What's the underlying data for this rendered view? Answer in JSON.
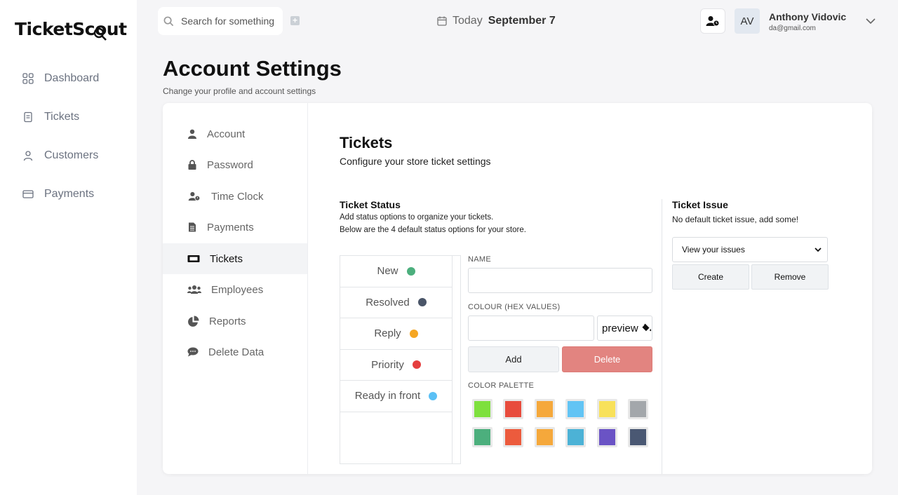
{
  "app": {
    "logo": "TicketScout"
  },
  "sidebar": {
    "items": [
      {
        "label": "Dashboard",
        "icon": "grid-icon"
      },
      {
        "label": "Tickets",
        "icon": "document-icon"
      },
      {
        "label": "Customers",
        "icon": "user-icon"
      },
      {
        "label": "Payments",
        "icon": "credit-card-icon"
      }
    ]
  },
  "header": {
    "search_placeholder": "Search for something",
    "today_label": "Today",
    "today_date": "September 7",
    "user_initials": "AV",
    "user_name": "Anthony Vidovic",
    "user_email": "da@gmail.com"
  },
  "page": {
    "title": "Account Settings",
    "subtitle": "Change your profile and account settings"
  },
  "settings_nav": {
    "active": "Tickets",
    "items": [
      {
        "label": "Account",
        "icon": "user-solid-icon"
      },
      {
        "label": "Password",
        "icon": "lock-icon"
      },
      {
        "label": "Time Clock",
        "icon": "user-clock-icon"
      },
      {
        "label": "Payments",
        "icon": "file-invoice-icon"
      },
      {
        "label": "Tickets",
        "icon": "ticket-icon"
      },
      {
        "label": "Employees",
        "icon": "users-icon"
      },
      {
        "label": "Reports",
        "icon": "pie-chart-icon"
      },
      {
        "label": "Delete Data",
        "icon": "comment-icon"
      }
    ]
  },
  "tickets": {
    "title": "Tickets",
    "subtitle": "Configure your store ticket settings",
    "status": {
      "title": "Ticket Status",
      "desc1": "Add status options to organize your tickets.",
      "desc2": "Below are the 4 default status options for your store.",
      "items": [
        {
          "label": "New",
          "color": "#4caf7d"
        },
        {
          "label": "Resolved",
          "color": "#4a5568"
        },
        {
          "label": "Reply",
          "color": "#f5a623"
        },
        {
          "label": "Priority",
          "color": "#e53e3e"
        },
        {
          "label": "Ready in front",
          "color": "#5bc0f5"
        }
      ]
    },
    "form": {
      "name_label": "NAME",
      "name_value": "",
      "colour_label": "COLOUR (HEX VALUES)",
      "colour_value": "",
      "preview_label": "preview",
      "add_label": "Add",
      "delete_label": "Delete",
      "palette_label": "COLOR PALETTE",
      "palette": [
        "#7ee03d",
        "#e84c3d",
        "#f5a83b",
        "#62c4f4",
        "#f8e15a",
        "#a3a7ab",
        "#4caf7d",
        "#ec5b3d",
        "#f5a83b",
        "#4cb2d6",
        "#6a53c5",
        "#4a5873"
      ]
    },
    "issue": {
      "title": "Ticket Issue",
      "desc": "No default ticket issue, add some!",
      "select_value": "View your issues",
      "create_label": "Create",
      "remove_label": "Remove"
    }
  }
}
